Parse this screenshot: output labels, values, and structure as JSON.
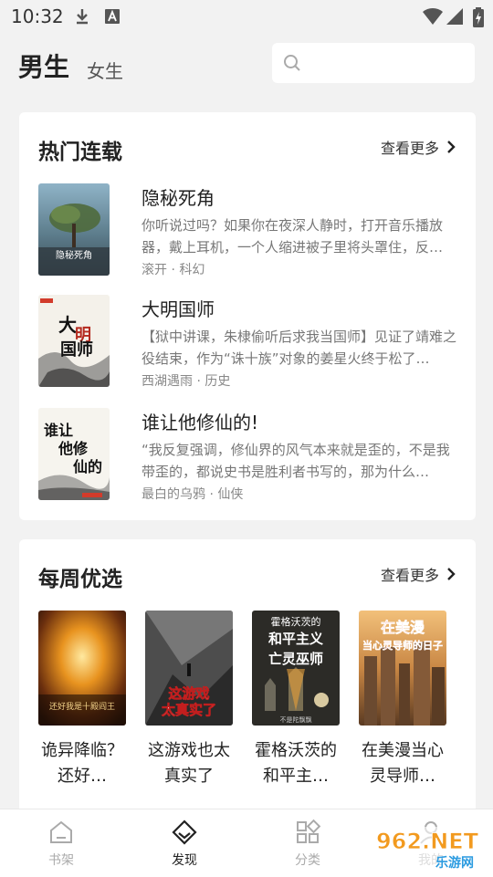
{
  "status": {
    "time": "10:32",
    "icons": [
      "download-icon",
      "a-badge-icon",
      "wifi-icon",
      "signal-icon",
      "battery-icon"
    ]
  },
  "header": {
    "tabs": [
      {
        "label": "男生",
        "active": true
      },
      {
        "label": "女生",
        "active": false
      }
    ],
    "search_icon": "search-icon"
  },
  "hot": {
    "title": "热门连载",
    "more": "查看更多",
    "books": [
      {
        "title": "隐秘死角",
        "desc": "你听说过吗？如果你在夜深人静时，打开音乐播放器，戴上耳机，一个人缩进被子里将头罩住，反…",
        "meta": "滚开 · 科幻",
        "cover_text": "隐秘死角"
      },
      {
        "title": "大明国师",
        "desc": "【狱中讲课，朱棣偷听后求我当国师】见证了靖难之役结束，作为“诛十族”对象的姜星火终于松了…",
        "meta": "西湖遇雨 · 历史",
        "cover_text": "大明国师"
      },
      {
        "title": "谁让他修仙的!",
        "desc": "“我反复强调，修仙界的风气本来就是歪的，不是我带歪的，都说史书是胜利者书写的，那为什么…",
        "meta": "最白的乌鸦 · 仙侠",
        "cover_text": "谁让他修仙的"
      }
    ]
  },
  "weekly": {
    "title": "每周优选",
    "more": "查看更多",
    "books": [
      {
        "title": "诡异降临？还好…",
        "cover_text": "诡异降临还好我是十级阎王"
      },
      {
        "title": "这游戏也太真实了",
        "cover_text": "这游戏也太真实了"
      },
      {
        "title": "霍格沃茨的和平主…",
        "cover_text": "霍格沃茨的和平主义亡灵巫师"
      },
      {
        "title": "在美漫当心灵导师…",
        "cover_text": "在美漫当心灵导师的日子"
      }
    ]
  },
  "nav": [
    {
      "label": "书架",
      "icon": "home-icon",
      "active": false
    },
    {
      "label": "发现",
      "icon": "compass-diamond-icon",
      "active": true
    },
    {
      "label": "分类",
      "icon": "category-grid-icon",
      "active": false
    },
    {
      "label": "我的",
      "icon": "profile-icon",
      "active": false
    }
  ],
  "watermark": {
    "brand": "962.NET",
    "sub": "乐游网"
  }
}
